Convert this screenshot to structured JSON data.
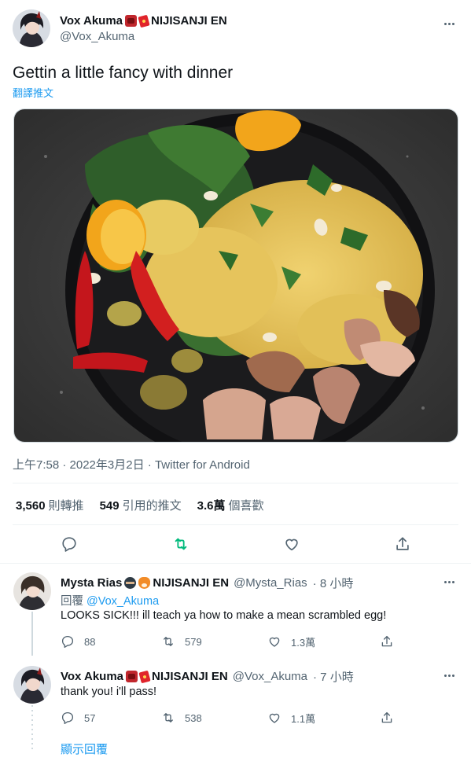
{
  "tweet": {
    "author_name": "Vox Akuma",
    "author_affiliation": "NIJISANJI EN",
    "author_handle": "@Vox_Akuma",
    "text": "Gettin a little fancy with dinner",
    "translate_label": "翻譯推文",
    "timestamp": "上午7:58 · 2022年3月2日",
    "source": "Twitter for Android",
    "stats": {
      "retweets_count": "3,560",
      "retweets_label": "則轉推",
      "quotes_count": "549",
      "quotes_label": "引用的推文",
      "likes_count": "3.6萬",
      "likes_label": "個喜歡"
    },
    "icons": [
      "more-icon",
      "reply-icon",
      "retweet-icon",
      "like-icon",
      "share-icon"
    ],
    "retweet_color": "#00ba7c"
  },
  "replies": [
    {
      "author_name": "Mysta Rias",
      "author_affiliation": "NIJISANJI EN",
      "author_handle": "@Mysta_Rias",
      "time": "· 8 小時",
      "replying_prefix": "回覆",
      "replying_to": "@Vox_Akuma",
      "text": "LOOKS SICK!!! ill teach ya how to make a mean scrambled egg!",
      "reply_count": "88",
      "retweet_count": "579",
      "like_count": "1.3萬"
    },
    {
      "author_name": "Vox Akuma",
      "author_affiliation": "NIJISANJI EN",
      "author_handle": "@Vox_Akuma",
      "time": "· 7 小時",
      "text": "thank you! i'll pass!",
      "reply_count": "57",
      "retweet_count": "538",
      "like_count": "1.1萬"
    }
  ],
  "show_replies_label": "顯示回覆",
  "colors": {
    "link": "#1d9bf0",
    "muted": "#536471",
    "text": "#0f1419"
  }
}
